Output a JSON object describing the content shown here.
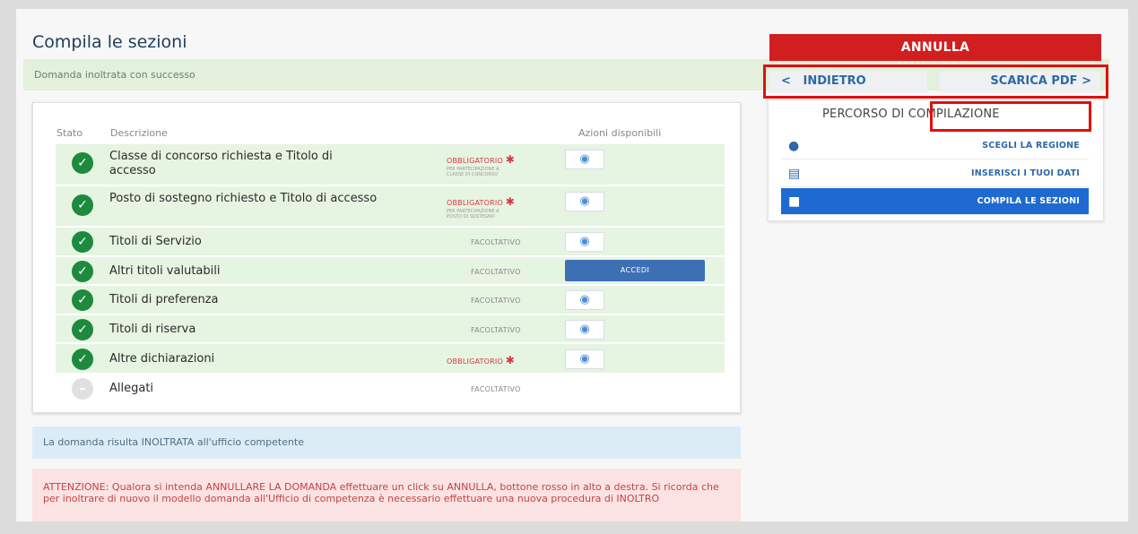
{
  "page_title": "Compila le sezioni",
  "success_message": "Domanda inoltrata con successo",
  "table": {
    "headers": {
      "stato": "Stato",
      "descrizione": "Descrizione",
      "azioni": "Azioni disponibili"
    },
    "rows": [
      {
        "status": "complete",
        "description": "Classe di concorso richiesta e Titolo di accesso",
        "requirement": "OBBLIGATORIO",
        "requirement_note": "PER PARTECIPAZIONE A CLASSE DI CONCORSO",
        "action": "view"
      },
      {
        "status": "complete",
        "description": "Posto di sostegno richiesto e Titolo di accesso",
        "requirement": "OBBLIGATORIO",
        "requirement_note": "PER PARTECIPAZIONE A POSTO DI SOSTEGNO",
        "action": "view"
      },
      {
        "status": "complete",
        "description": "Titoli di Servizio",
        "requirement": "FACOLTATIVO",
        "action": "view"
      },
      {
        "status": "complete",
        "description": "Altri titoli valutabili",
        "requirement": "FACOLTATIVO",
        "action": "ACCEDI"
      },
      {
        "status": "complete",
        "description": "Titoli di preferenza",
        "requirement": "FACOLTATIVO",
        "action": "view"
      },
      {
        "status": "complete",
        "description": "Titoli di riserva",
        "requirement": "FACOLTATIVO",
        "action": "view"
      },
      {
        "status": "complete",
        "description": "Altre dichiarazioni",
        "requirement": "OBBLIGATORIO",
        "action": "view"
      },
      {
        "status": "pending",
        "description": "Allegati",
        "requirement": "FACOLTATIVO",
        "action": ""
      }
    ]
  },
  "info_message": "La domanda risulta INOLTRATA all'ufficio competente",
  "warning_message": "ATTENZIONE: Qualora si intenda ANNULLARE LA DOMANDA effettuare un click su ANNULLA, bottone rosso in alto a destra. Si ricorda che per inoltrare di nuovo il modello domanda all'Ufficio di competenza è necessario effettuare una nuova procedura di INOLTRO",
  "sidebar": {
    "annulla_label": "ANNULLA",
    "back_label": "INDIETRO",
    "back_icon": "chevron-left-icon",
    "pdf_label": "SCARICA PDF",
    "pdf_icon": "chevron-right-icon",
    "percorso_title": "PERCORSO DI COMPILAZIONE",
    "steps": [
      {
        "label": "SCEGLI LA REGIONE",
        "icon": "map-pin-icon",
        "active": false
      },
      {
        "label": "INSERISCI I TUOI DATI",
        "icon": "id-card-icon",
        "active": false
      },
      {
        "label": "COMPILA LE SEZIONI",
        "icon": "briefcase-icon",
        "active": true
      }
    ]
  },
  "colors": {
    "annulla": "#d11f1f",
    "highlight": "#e20f0f",
    "success_bg": "#e3f0dc",
    "row_complete_bg": "#e6f4e2",
    "active_step": "#1e6ad1"
  }
}
